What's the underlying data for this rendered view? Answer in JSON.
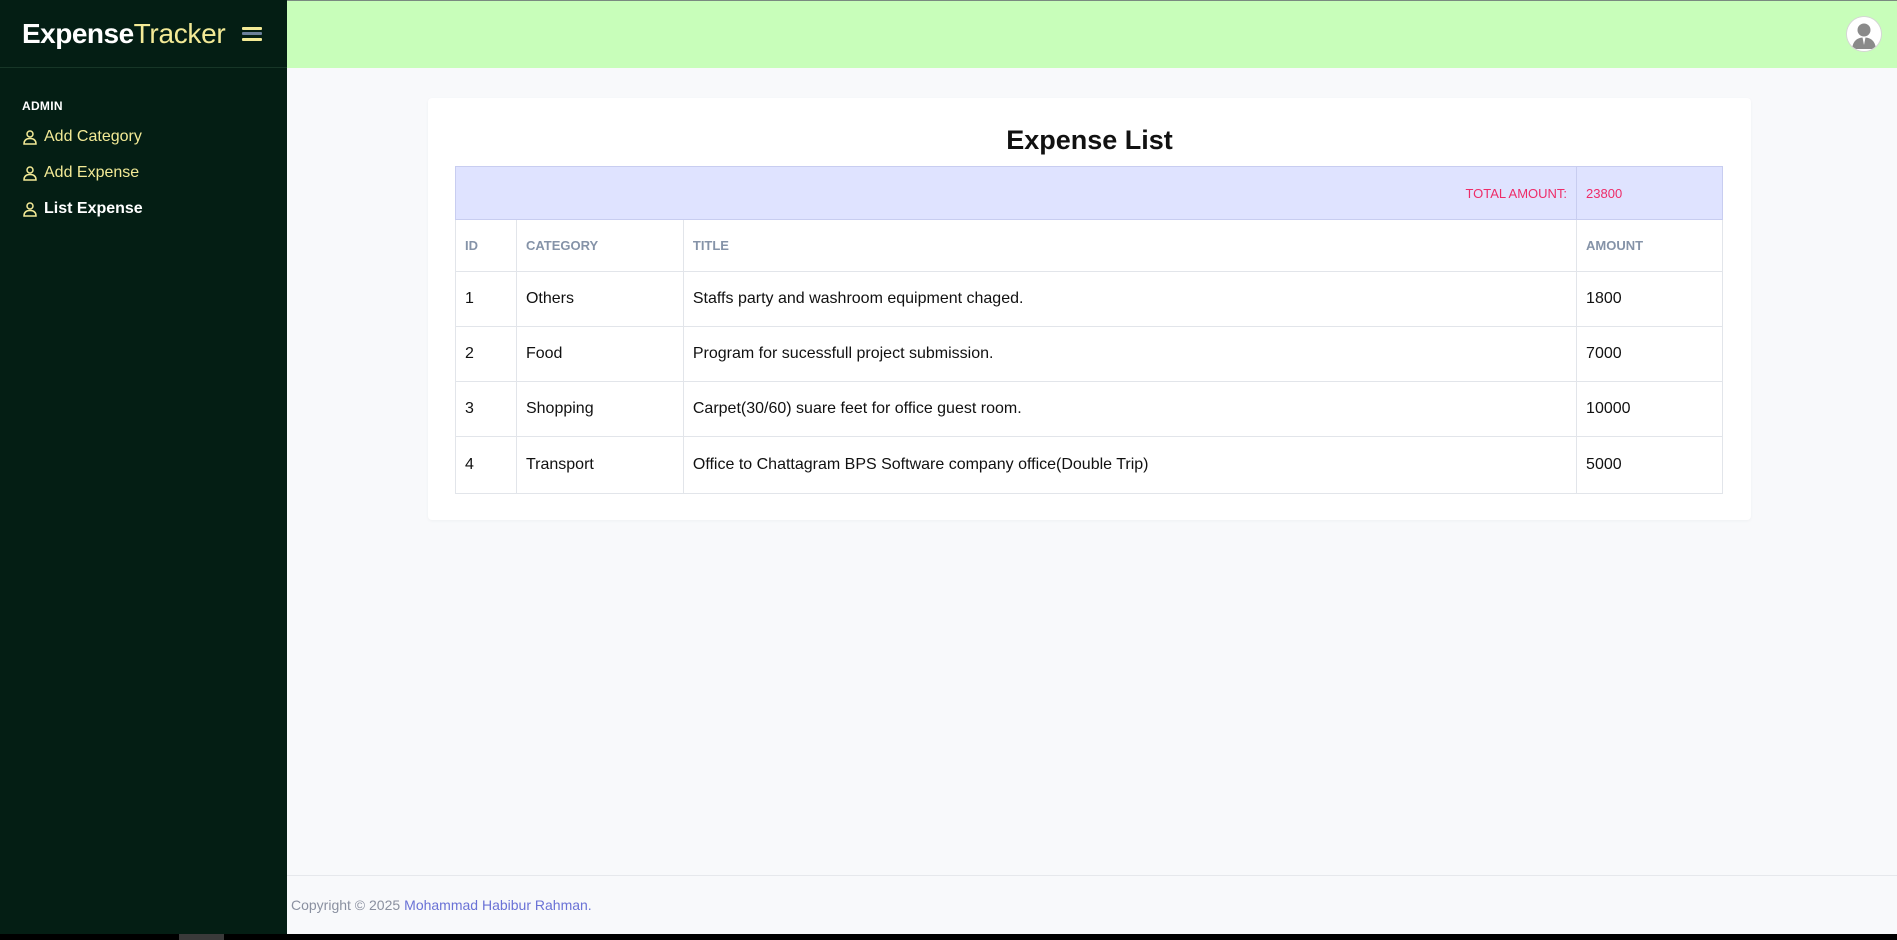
{
  "brand": {
    "strong": "Expense",
    "light": "Tracker"
  },
  "sidebar": {
    "section_label": "ADMIN",
    "items": [
      {
        "label": "Add Category",
        "icon": "user-icon",
        "active": false
      },
      {
        "label": "Add Expense",
        "icon": "user-icon",
        "active": false
      },
      {
        "label": "List Expense",
        "icon": "user-icon",
        "active": true
      }
    ]
  },
  "header": {
    "avatar_icon": "avatar-icon"
  },
  "main": {
    "title": "Expense List",
    "total_label": "TOTAL AMOUNT:",
    "total_value": "23800",
    "columns": [
      "ID",
      "CATEGORY",
      "TITLE",
      "AMOUNT"
    ],
    "rows": [
      {
        "id": "1",
        "category": "Others",
        "title": "Staffs party and washroom equipment chaged.",
        "amount": "1800"
      },
      {
        "id": "2",
        "category": "Food",
        "title": "Program for sucessfull project submission.",
        "amount": "7000"
      },
      {
        "id": "3",
        "category": "Shopping",
        "title": "Carpet(30/60) suare feet for office guest room.",
        "amount": "10000"
      },
      {
        "id": "4",
        "category": "Transport",
        "title": "Office to Chattagram BPS Software company office(Double Trip)",
        "amount": "5000"
      }
    ]
  },
  "footer": {
    "copyright": "Copyright © 2025",
    "author": "Mohammad Habibur Rahman."
  },
  "colors": {
    "sidebar_bg": "#041e14",
    "accent_yellow": "#f3ea96",
    "topbar_bg": "#c8feba",
    "total_row_bg": "#dfe3ff",
    "total_text": "#ee2c68",
    "link": "#6a72d6"
  }
}
